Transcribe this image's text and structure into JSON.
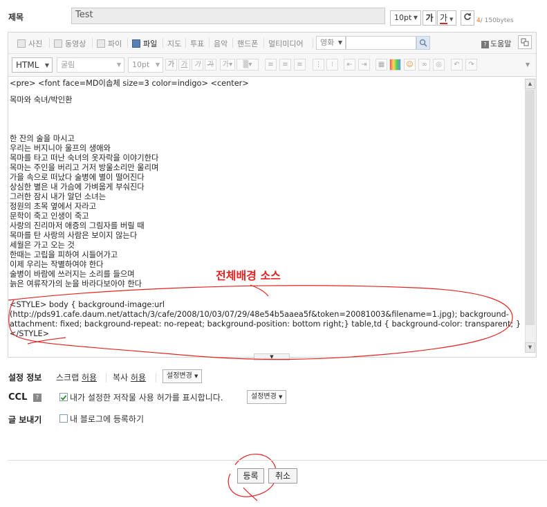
{
  "title_row": {
    "label": "제목",
    "value": "Test",
    "font_size": "10pt",
    "bold_label": "가",
    "color_label": "가",
    "count": "4",
    "limit": "/ 150bytes"
  },
  "toolbar1": {
    "items": [
      "사진",
      "동영상",
      "파이",
      "파일",
      "지도",
      "투표",
      "음악",
      "핸드폰",
      "멀티미디어"
    ],
    "search_select": "영화",
    "help": "도움말"
  },
  "toolbar2": {
    "mode": "HTML",
    "font": "굴림",
    "size": "10pt"
  },
  "editor_lines": [
    "<pre> <font face=MD이솝체 size=3 color=indigo> <center>",
    "",
    "목마와 숙녀/박인환",
    "",
    "",
    "",
    "한 잔의 술을 마시고",
    "우리는 버지니아 울프의 생애와",
    "목마를 타고 떠난 숙녀의 옷자락을 이야기한다",
    "목마는 주인을 버리고 거저 방울소리만 울리며",
    "가을 속으로 떠났다 술병에 별이 떨어진다",
    "상심한 별은 내 가슴에 가벼웁게 부숴진다",
    "그러한 잠시 내가 알던 소녀는",
    "정원의 초목 옆에서 자라고",
    "문학이 죽고 인생이 죽고",
    "사랑의 진리마저 애증의 그림자를 버릴 때",
    "목마를 탄 사랑의 사람은 보이지 않는다",
    "세월은 가고 오는 것",
    "한때는 고립을 피하여 시들어가고",
    "이제 우리는 작별하여야 한다",
    "술병이 바람에 쓰러지는 소리를 들으며",
    "늙은 여류작가의 눈을 바라다보아야 한다",
    "",
    "<STYLE> body { background-image:url",
    "(http://pds91.cafe.daum.net/attach/3/cafe/2008/10/03/07/29/48e54b5aaea5f&token=20081003&filename=1.jpg); background-",
    "attachment: fixed; background-repeat: no-repeat; background-position: bottom right;} table,td { background-color: transparent; }",
    "</STYLE>"
  ],
  "annotation": "전체배경 소스",
  "settings": {
    "info_label": "설정 정보",
    "scrap_label": "스크랩",
    "scrap_value": "허용",
    "copy_label": "복사",
    "copy_value": "허용",
    "change_btn": "설정변경",
    "ccl_label": "CCL",
    "ccl_text": "내가 설정한 저작물 사용 허가를 표시합니다.",
    "ccl_change_btn": "설정변경",
    "send_label": "글 보내기",
    "send_text": "내 블로그에 등록하기"
  },
  "actions": {
    "submit": "등록",
    "cancel": "취소"
  },
  "colors": {
    "accent_red": "#e52222",
    "count_orange": "#e8731a"
  }
}
